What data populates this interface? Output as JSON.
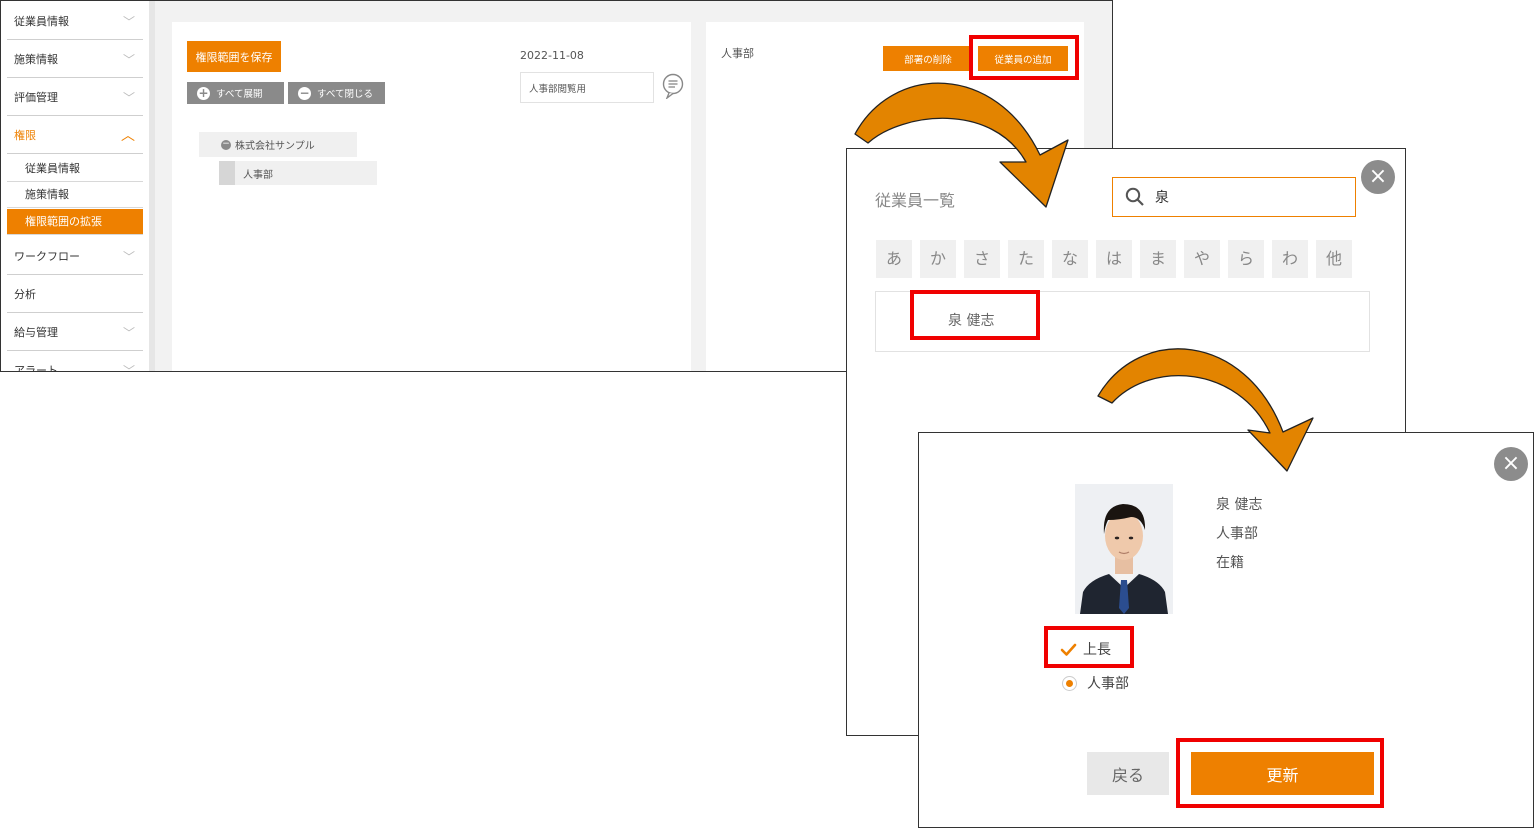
{
  "sidebar": {
    "items": [
      {
        "label": "従業員情報"
      },
      {
        "label": "施策情報"
      },
      {
        "label": "評価管理"
      },
      {
        "label": "権限"
      },
      {
        "label": "ワークフロー"
      },
      {
        "label": "分析"
      },
      {
        "label": "給与管理"
      },
      {
        "label": "アラート"
      }
    ],
    "sub_items": [
      {
        "label": "従業員情報"
      },
      {
        "label": "施策情報"
      },
      {
        "label": "権限範囲の拡張"
      }
    ]
  },
  "left_panel": {
    "save_button": "権限範囲を保存",
    "date": "2022-11-08",
    "memo_placeholder": "人事部閲覧用",
    "expand_all": "すべて展開",
    "collapse_all": "すべて閉じる",
    "tree": {
      "root": "株式会社サンプル",
      "child": "人事部"
    }
  },
  "right_panel": {
    "department_name": "人事部",
    "delete_button": "部署の削除",
    "add_employee_button": "従業員の追加"
  },
  "employee_dialog": {
    "title": "従業員一覧",
    "search_value": "泉",
    "kana_tabs": [
      "あ",
      "か",
      "さ",
      "た",
      "な",
      "は",
      "ま",
      "や",
      "ら",
      "わ",
      "他"
    ],
    "result_name": "泉 健志",
    "close": "×"
  },
  "detail_dialog": {
    "name": "泉 健志",
    "department": "人事部",
    "status": "在籍",
    "supervisor_label": "上長",
    "radio_label": "人事部",
    "back_button": "戻る",
    "update_button": "更新",
    "close": "×"
  },
  "colors": {
    "accent": "#ee8000",
    "highlight": "#f00000",
    "arrow": "#e38400"
  }
}
